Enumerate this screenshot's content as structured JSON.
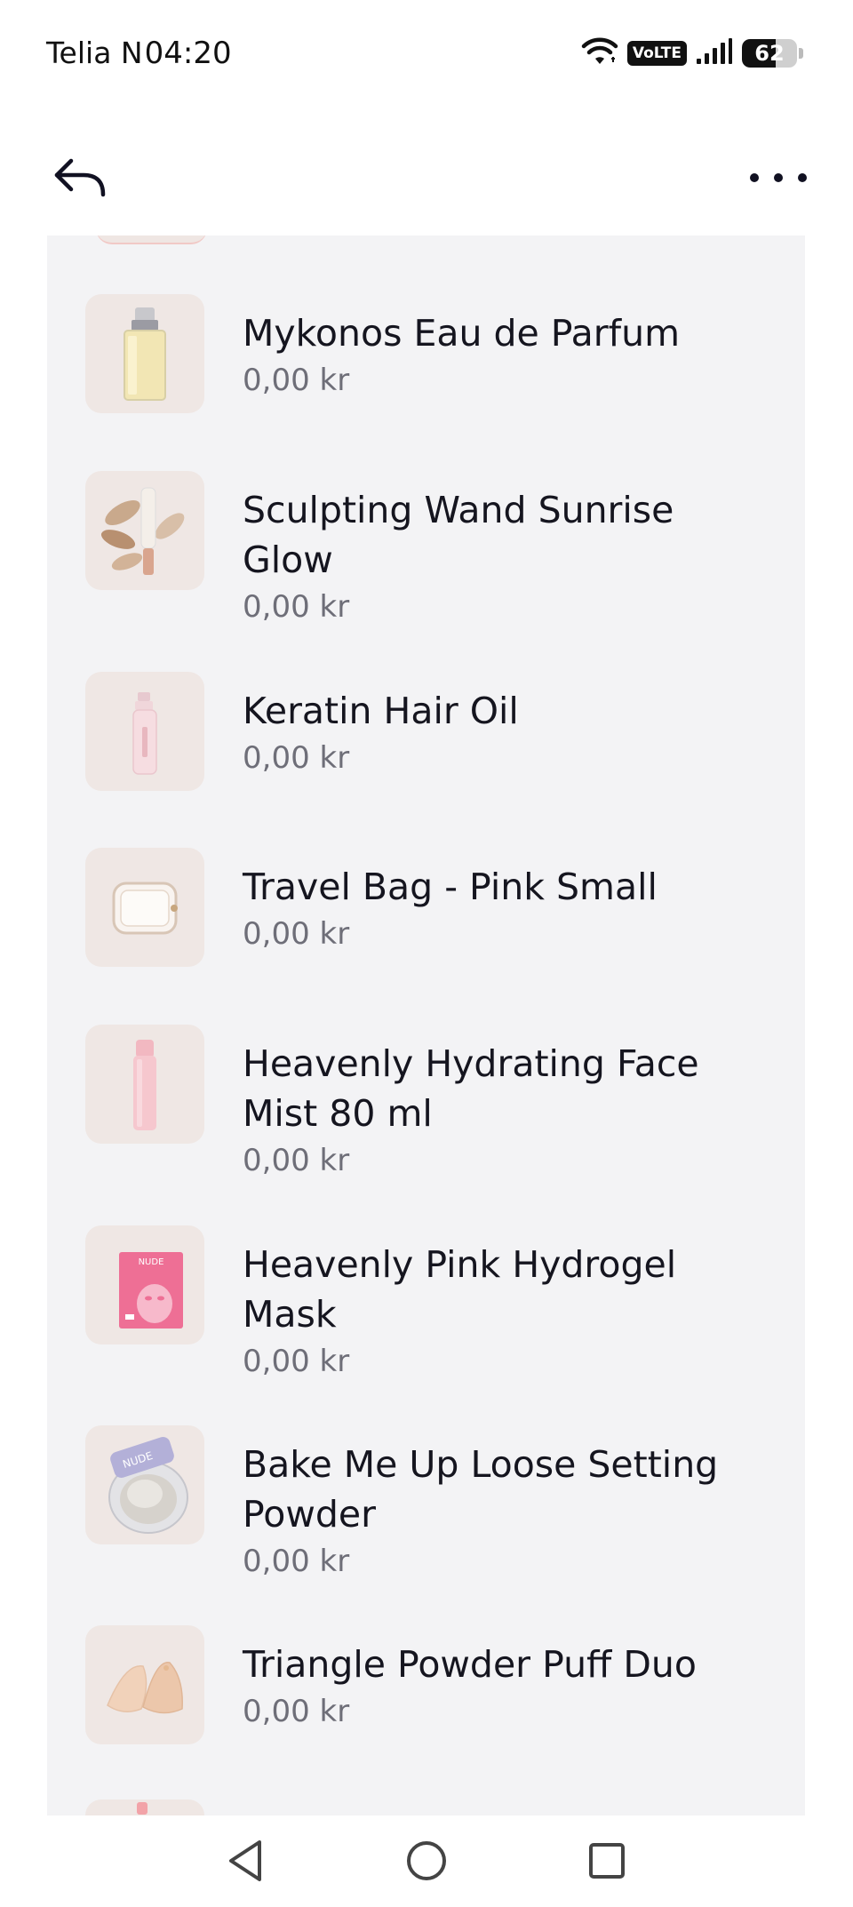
{
  "status_bar": {
    "carrier": "Telia N",
    "time": "04:20",
    "network_badge": "VoLTE",
    "battery_percent": "62",
    "battery_level": 0.62,
    "icons": [
      "wifi-icon",
      "signal-icon",
      "battery-icon"
    ]
  },
  "app_bar": {
    "back_icon": "back-arrow-icon",
    "menu_icon": "more-options-icon"
  },
  "products": [
    {
      "name": "Mykonos Eau de Parfum",
      "price": "0,00 kr",
      "icon": "perfume-bottle-image"
    },
    {
      "name": "Sculpting Wand Sunrise Glow",
      "price": "0,00 kr",
      "icon": "sculpting-wand-image"
    },
    {
      "name": "Keratin Hair Oil",
      "price": "0,00 kr",
      "icon": "hair-oil-bottle-image"
    },
    {
      "name": "Travel Bag - Pink Small",
      "price": "0,00 kr",
      "icon": "travel-bag-image"
    },
    {
      "name": "Heavenly Hydrating Face Mist 80 ml",
      "price": "0,00 kr",
      "icon": "face-mist-bottle-image"
    },
    {
      "name": "Heavenly Pink Hydrogel Mask",
      "price": "0,00 kr",
      "icon": "hydrogel-mask-image",
      "brand_text": "NUDE"
    },
    {
      "name": "Bake Me Up Loose Setting Powder",
      "price": "0,00 kr",
      "icon": "setting-powder-image",
      "brand_text": "NUDE"
    },
    {
      "name": "Triangle Powder Puff Duo",
      "price": "0,00 kr",
      "icon": "powder-puff-image"
    }
  ],
  "nav_bar": {
    "icons": [
      "nav-back-icon",
      "nav-home-icon",
      "nav-recents-icon"
    ]
  },
  "colors": {
    "list_background": "#f3f3f5",
    "thumb_background": "#efe7e4",
    "text_primary": "#15151f",
    "text_secondary": "#6e6e78"
  }
}
